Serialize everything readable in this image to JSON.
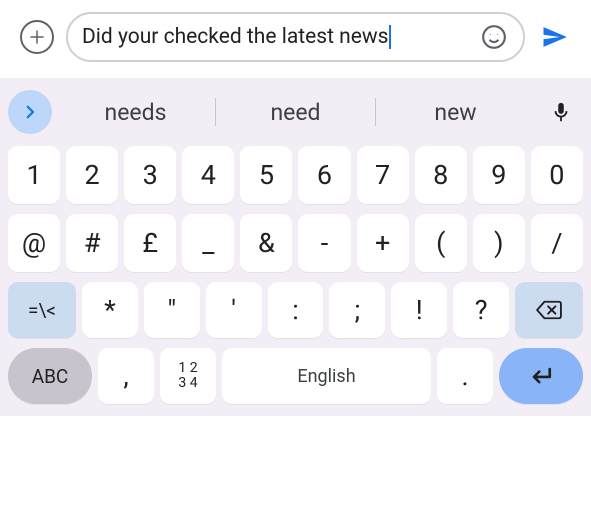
{
  "input": {
    "text_prefix": "Did ",
    "text_error": "your checked",
    "text_mid": " the latest ",
    "text_suffix": "news"
  },
  "suggestions": {
    "items": [
      "needs",
      "need",
      "new"
    ]
  },
  "keyboard": {
    "row1": [
      "1",
      "2",
      "3",
      "4",
      "5",
      "6",
      "7",
      "8",
      "9",
      "0"
    ],
    "row2": [
      "@",
      "#",
      "£",
      "_",
      "&",
      "-",
      "+",
      "(",
      ")",
      "/"
    ],
    "row3_sym": "=\\<",
    "row3": [
      "*",
      "\"",
      "'",
      ":",
      ";",
      "!",
      "?"
    ],
    "bottom": {
      "abc": "ABC",
      "comma": ",",
      "numgrid": "1 2\n3 4",
      "space": "English",
      "period": "."
    }
  }
}
